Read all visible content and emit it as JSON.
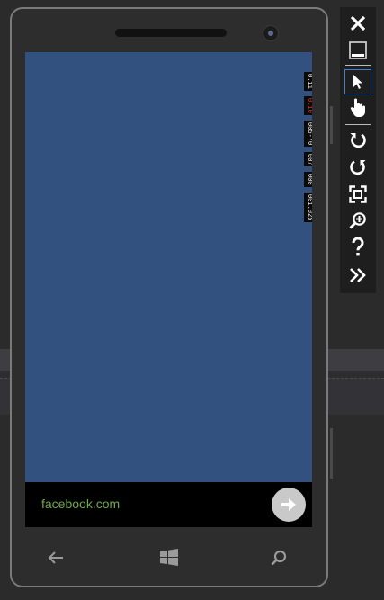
{
  "browser": {
    "url": "facebook.com"
  },
  "perf_counters": [
    {
      "value": "0.11",
      "color": "#ffffff"
    },
    {
      "value": "0.10",
      "color": "#ff3030"
    },
    {
      "value": "005-70",
      "color": "#ffffff"
    },
    {
      "value": "007",
      "color": "#ffffff"
    },
    {
      "value": "000",
      "color": "#ffffff"
    },
    {
      "value": "001.025",
      "color": "#ffffff"
    }
  ],
  "toolbar": {
    "items": [
      {
        "name": "close-icon"
      },
      {
        "name": "minimize-icon"
      },
      {
        "name": "pointer-icon",
        "active": true
      },
      {
        "name": "touch-icon"
      },
      {
        "name": "rotate-left-icon"
      },
      {
        "name": "rotate-right-icon"
      },
      {
        "name": "fit-screen-icon"
      },
      {
        "name": "zoom-icon"
      },
      {
        "name": "help-icon"
      },
      {
        "name": "more-icon"
      }
    ]
  },
  "phone_nav": [
    "back-icon",
    "windows-start-icon",
    "search-icon"
  ],
  "colors": {
    "screen_bg": "#32517f",
    "url_text": "#6fa84a",
    "toolbar_accent": "#3d7fd0"
  }
}
